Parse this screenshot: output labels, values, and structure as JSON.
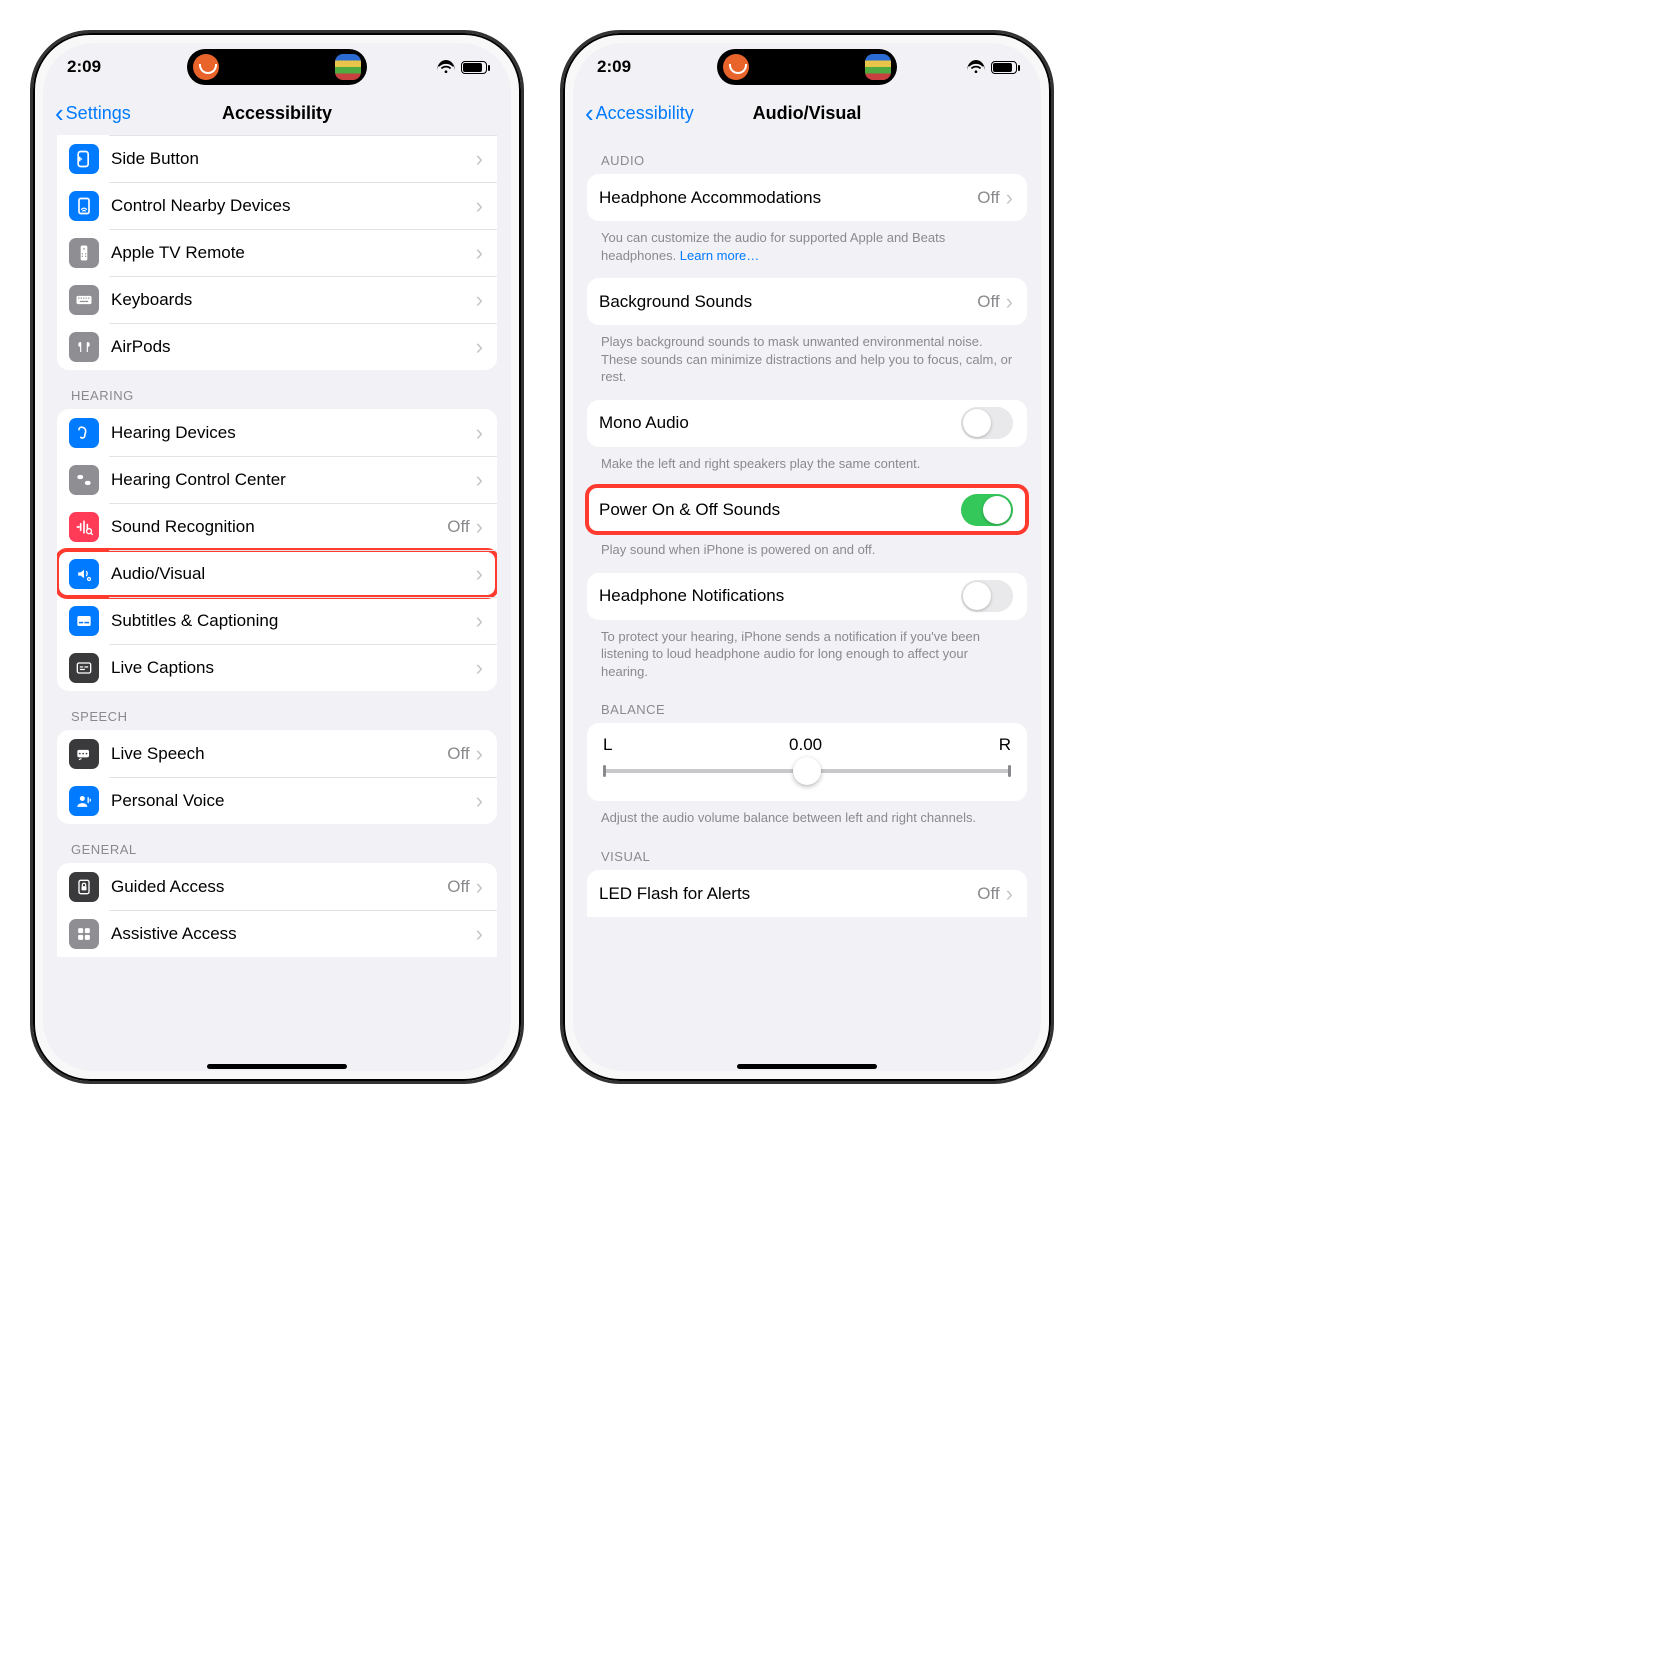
{
  "status": {
    "time": "2:09"
  },
  "left": {
    "back": "Settings",
    "title": "Accessibility",
    "groups": [
      {
        "rows": [
          {
            "label": "Side Button"
          },
          {
            "label": "Control Nearby Devices"
          },
          {
            "label": "Apple TV Remote"
          },
          {
            "label": "Keyboards"
          },
          {
            "label": "AirPods"
          }
        ]
      },
      {
        "header": "HEARING",
        "rows": [
          {
            "label": "Hearing Devices"
          },
          {
            "label": "Hearing Control Center"
          },
          {
            "label": "Sound Recognition",
            "value": "Off"
          },
          {
            "label": "Audio/Visual",
            "highlight": true
          },
          {
            "label": "Subtitles & Captioning"
          },
          {
            "label": "Live Captions"
          }
        ]
      },
      {
        "header": "SPEECH",
        "rows": [
          {
            "label": "Live Speech",
            "value": "Off"
          },
          {
            "label": "Personal Voice"
          }
        ]
      },
      {
        "header": "GENERAL",
        "rows": [
          {
            "label": "Guided Access",
            "value": "Off"
          },
          {
            "label": "Assistive Access"
          }
        ]
      }
    ]
  },
  "right": {
    "back": "Accessibility",
    "title": "Audio/Visual",
    "sections": {
      "audioHeader": "AUDIO",
      "headphoneAcc": {
        "label": "Headphone Accommodations",
        "value": "Off"
      },
      "headphoneAccFooter": "You can customize the audio for supported Apple and Beats headphones. ",
      "learnMore": "Learn more…",
      "bgSounds": {
        "label": "Background Sounds",
        "value": "Off"
      },
      "bgSoundsFooter": "Plays background sounds to mask unwanted environmental noise. These sounds can minimize distractions and help you to focus, calm, or rest.",
      "monoAudio": {
        "label": "Mono Audio"
      },
      "monoAudioFooter": "Make the left and right speakers play the same content.",
      "powerSounds": {
        "label": "Power On & Off Sounds",
        "on": true,
        "highlight": true
      },
      "powerSoundsFooter": "Play sound when iPhone is powered on and off.",
      "headphoneNotif": {
        "label": "Headphone Notifications"
      },
      "headphoneNotifFooter": "To protect your hearing, iPhone sends a notification if you've been listening to loud headphone audio for long enough to affect your hearing.",
      "balanceHeader": "BALANCE",
      "balance": {
        "left": "L",
        "value": "0.00",
        "right": "R"
      },
      "balanceFooter": "Adjust the audio volume balance between left and right channels.",
      "visualHeader": "VISUAL",
      "ledFlash": {
        "label": "LED Flash for Alerts",
        "value": "Off"
      }
    }
  }
}
